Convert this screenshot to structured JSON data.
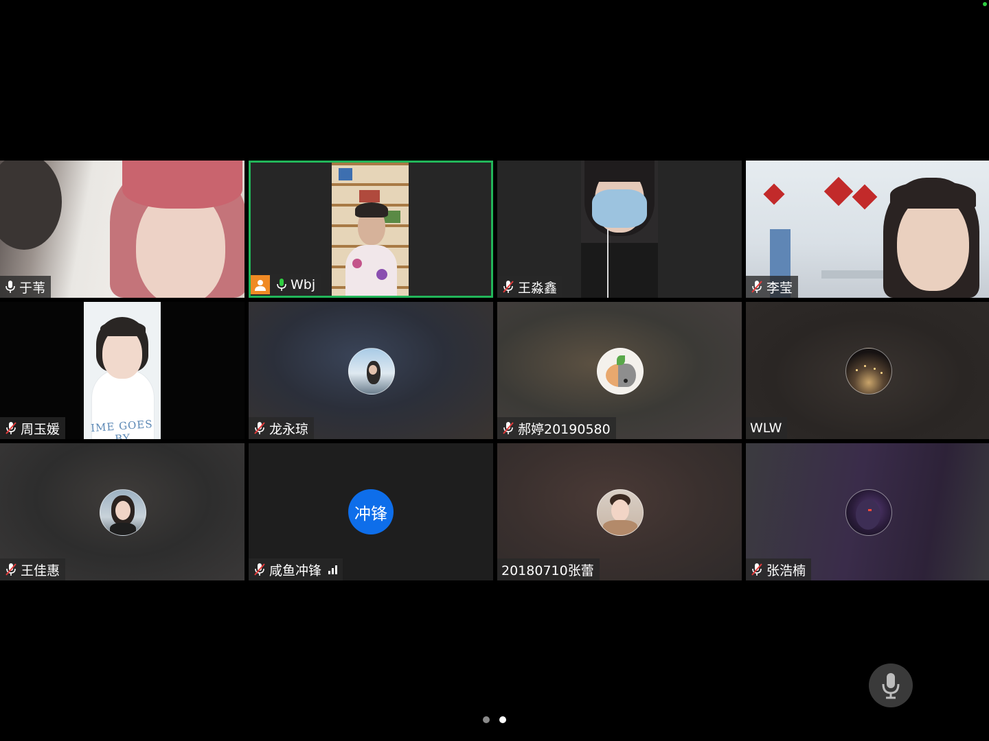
{
  "participants": [
    {
      "name": "于苇",
      "mic": "unmuted",
      "kind": "video"
    },
    {
      "name": "Wbj",
      "mic": "unmuted",
      "kind": "video",
      "host": true,
      "speaking": true
    },
    {
      "name": "王淼鑫",
      "mic": "muted",
      "kind": "video"
    },
    {
      "name": "李莹",
      "mic": "muted",
      "kind": "video"
    },
    {
      "name": "周玉媛",
      "mic": "muted",
      "kind": "video",
      "shirt_text": "IME GOES BY"
    },
    {
      "name": "龙永琼",
      "mic": "muted",
      "kind": "avatar"
    },
    {
      "name": "郝婷20190580",
      "mic": "muted",
      "kind": "avatar"
    },
    {
      "name": "WLW",
      "mic": "none",
      "kind": "avatar"
    },
    {
      "name": "王佳惠",
      "mic": "muted",
      "kind": "avatar"
    },
    {
      "name": "咸鱼冲锋",
      "mic": "muted",
      "kind": "text-avatar",
      "avatar_text": "冲锋",
      "signal": true
    },
    {
      "name": "20180710张蕾",
      "mic": "none",
      "kind": "avatar"
    },
    {
      "name": "张浩楠",
      "mic": "muted",
      "kind": "avatar"
    }
  ],
  "colors": {
    "speaking_border": "#22b65a",
    "host_badge": "#f08a24",
    "text_avatar": "#0e6eea",
    "mic_muted": "#e23b3b",
    "mic_live": "#2ecc40"
  },
  "pagination": {
    "pages": 2,
    "current": 2
  }
}
